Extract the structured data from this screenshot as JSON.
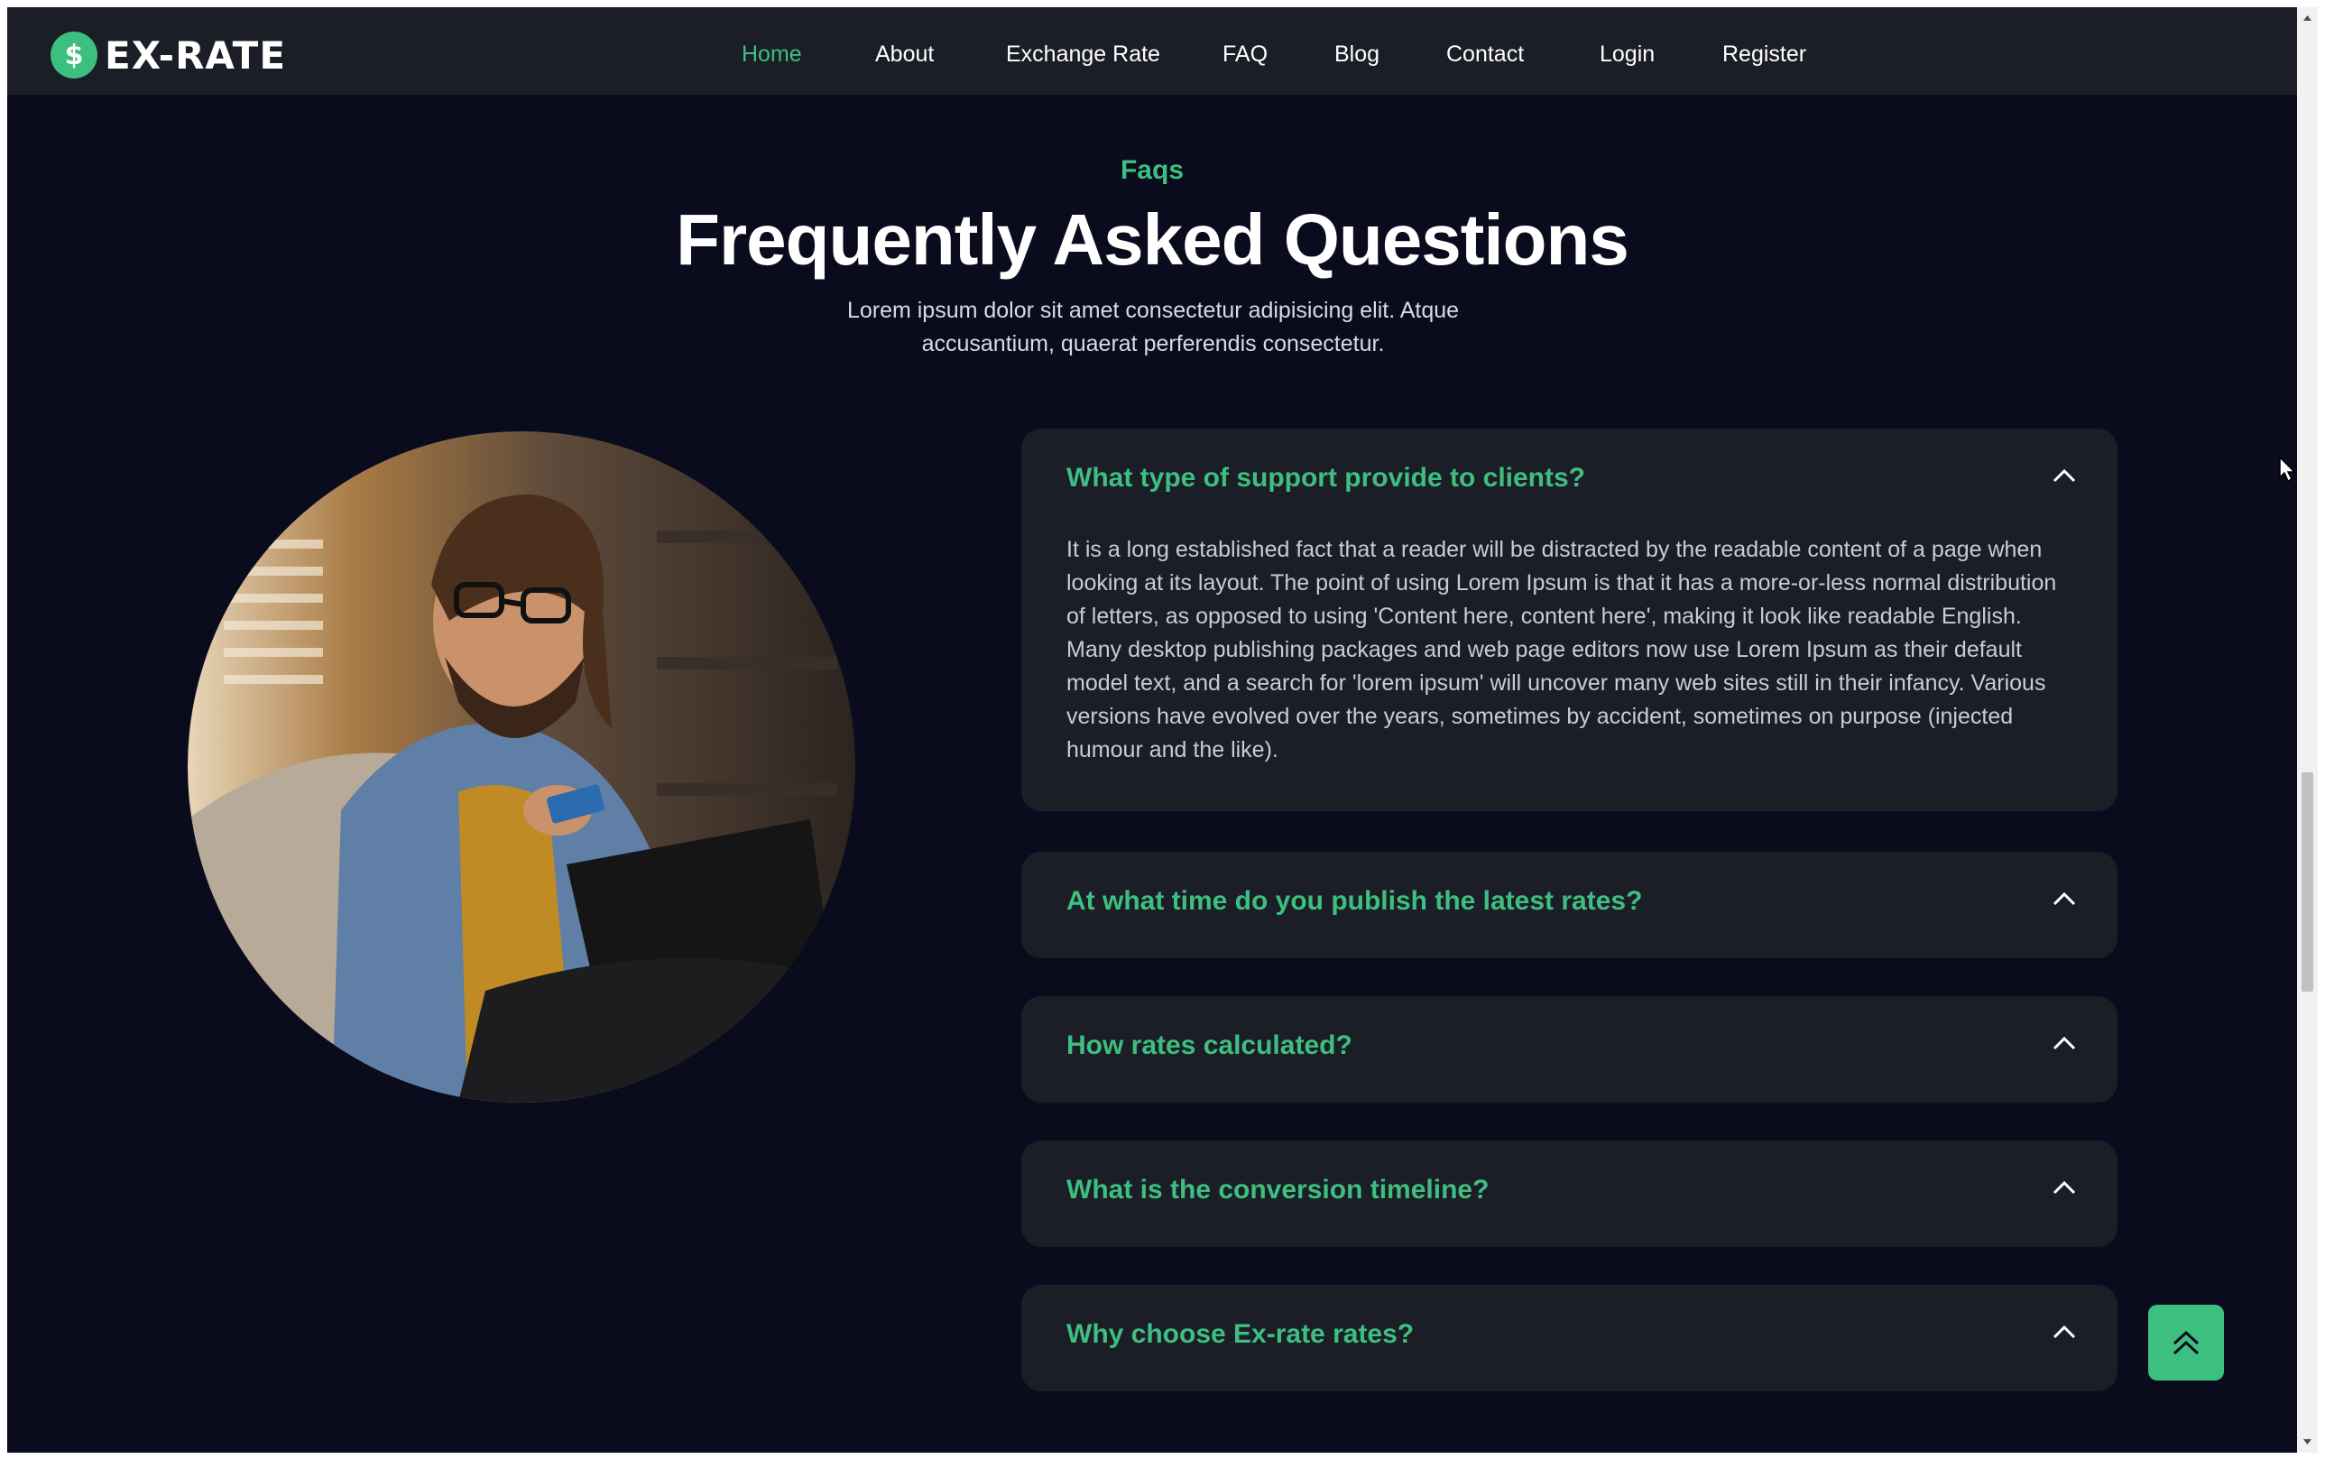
{
  "header": {
    "logo_symbol": "$",
    "logo_text": "EX-RATE",
    "nav": [
      {
        "label": "Home",
        "active": true
      },
      {
        "label": "About"
      },
      {
        "label": "Exchange Rate"
      },
      {
        "label": "FAQ"
      },
      {
        "label": "Blog"
      },
      {
        "label": "Contact"
      },
      {
        "label": "Login"
      },
      {
        "label": "Register"
      }
    ]
  },
  "faq_section": {
    "eyebrow": "Faqs",
    "title": "Frequently Asked Questions",
    "subtitle": "Lorem ipsum dolor sit amet consectetur adipisicing elit. Atque accusantium, quaerat perferendis consectetur.",
    "items": [
      {
        "question": "What type of support provide to clients?",
        "expanded": true,
        "answer": "It is a long established fact that a reader will be distracted by the readable content of a page when looking at its layout. The point of using Lorem Ipsum is that it has a more-or-less normal distribution of letters, as opposed to using 'Content here, content here', making it look like readable English. Many desktop publishing packages and web page editors now use Lorem Ipsum as their default model text, and a search for 'lorem ipsum' will uncover many web sites still in their infancy. Various versions have evolved over the years, sometimes by accident, sometimes on purpose (injected humour and the like)."
      },
      {
        "question": "At what time do you publish the latest rates?",
        "expanded": false
      },
      {
        "question": "How rates calculated?",
        "expanded": false
      },
      {
        "question": "What is the conversion timeline?",
        "expanded": false
      },
      {
        "question": "Why choose Ex-rate rates?",
        "expanded": false
      }
    ]
  },
  "icons": {
    "chevron": "chevron-up-icon",
    "back_to_top": "double-chevron-up-icon",
    "cursor": "mouse-pointer-icon"
  },
  "colors": {
    "accent": "#3dbf80",
    "page_bg": "#0a0b1d",
    "card_bg": "#1b1d27",
    "text": "#ffffff"
  }
}
